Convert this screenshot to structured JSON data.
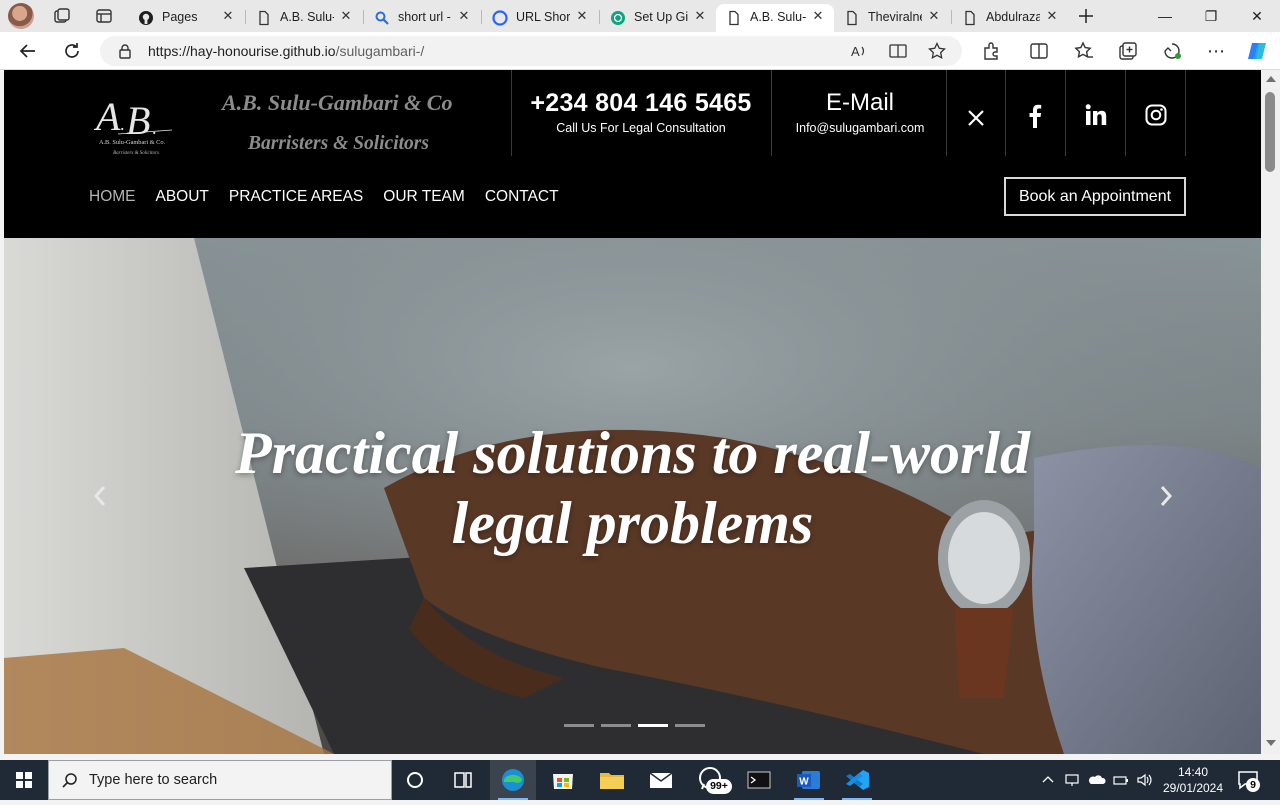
{
  "browser": {
    "tabs": [
      {
        "label": "Pages",
        "icon": "github-icon",
        "active": false
      },
      {
        "label": "A.B. Sulu-",
        "icon": "page-icon",
        "active": false
      },
      {
        "label": "short url -",
        "icon": "search-icon",
        "active": false
      },
      {
        "label": "URL Short",
        "icon": "link-icon",
        "active": false
      },
      {
        "label": "Set Up Git",
        "icon": "chatgpt-icon",
        "active": false
      },
      {
        "label": "A.B. Sulu-",
        "icon": "page-icon",
        "active": true
      },
      {
        "label": "Theviralne",
        "icon": "page-icon",
        "active": false
      },
      {
        "label": "Abdulraza",
        "icon": "page-icon",
        "active": false
      }
    ],
    "url_host": "https://hay-honourise.github.io",
    "url_path": "/sulugambari-/"
  },
  "site": {
    "logo_text": "A.B. Sulu-Gambari & Co.",
    "logo_sub": "Barristers & Solicitors",
    "firm_name": "A.B. Sulu-Gambari & Co",
    "firm_sub": "Barristers & Solicitors",
    "phone": "+234 804 146 5465",
    "phone_caption": "Call Us For Legal Consultation",
    "email_title": "E-Mail",
    "email": "Info@sulugambari.com",
    "nav": [
      "HOME",
      "ABOUT",
      "PRACTICE AREAS",
      "OUR TEAM",
      "CONTACT"
    ],
    "current_nav": "HOME",
    "book_button": "Book an Appointment",
    "hero_line1": "Practical solutions to real-world",
    "hero_line2": "legal problems",
    "slides_total": 4,
    "slide_active": 3
  },
  "taskbar": {
    "search_placeholder": "Type here to search",
    "whatsapp_badge": "99+",
    "time": "14:40",
    "date": "29/01/2024",
    "notifications": "9"
  },
  "colors": {
    "header_bg": "#000000",
    "nav_current": "#b5b5b5",
    "firm_name": "#8c8c8c"
  }
}
